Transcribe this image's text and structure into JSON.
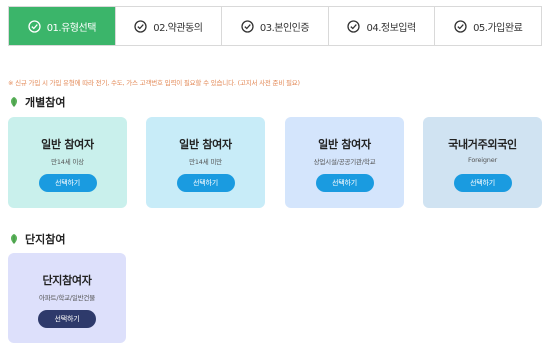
{
  "steps": [
    {
      "label": "01.유형선택",
      "active": true
    },
    {
      "label": "02.약관동의",
      "active": false
    },
    {
      "label": "03.본인인증",
      "active": false
    },
    {
      "label": "04.정보입력",
      "active": false
    },
    {
      "label": "05.가입완료",
      "active": false
    }
  ],
  "notice": "※ 신규 가입 시 가입 유형에 따라 전기, 수도, 가스 고객번호 입력이 필요할 수 있습니다. (고지서 사전 준비 필요)",
  "sections": {
    "individual": {
      "title": "개별참여",
      "cards": [
        {
          "name": "일반 참여자",
          "sub": "만14세 이상",
          "button": "선택하기"
        },
        {
          "name": "일반 참여자",
          "sub": "만14세 미만",
          "button": "선택하기"
        },
        {
          "name": "일반 참여자",
          "sub": "상업시설/공공기관/학교",
          "button": "선택하기"
        },
        {
          "name": "국내거주외국인",
          "sub": "Foreigner",
          "button": "선택하기"
        }
      ]
    },
    "complex": {
      "title": "단지참여",
      "cards": [
        {
          "name": "단지참여자",
          "sub": "아파트/학교/일반건물",
          "button": "선택하기"
        }
      ]
    }
  },
  "colors": {
    "accent_green": "#3bb56a",
    "button_blue": "#1a9be0",
    "button_navy": "#2e3a6b",
    "notice_orange": "#e38a58"
  },
  "icons": {
    "step": "check-circle-icon",
    "section": "leaf-icon"
  }
}
